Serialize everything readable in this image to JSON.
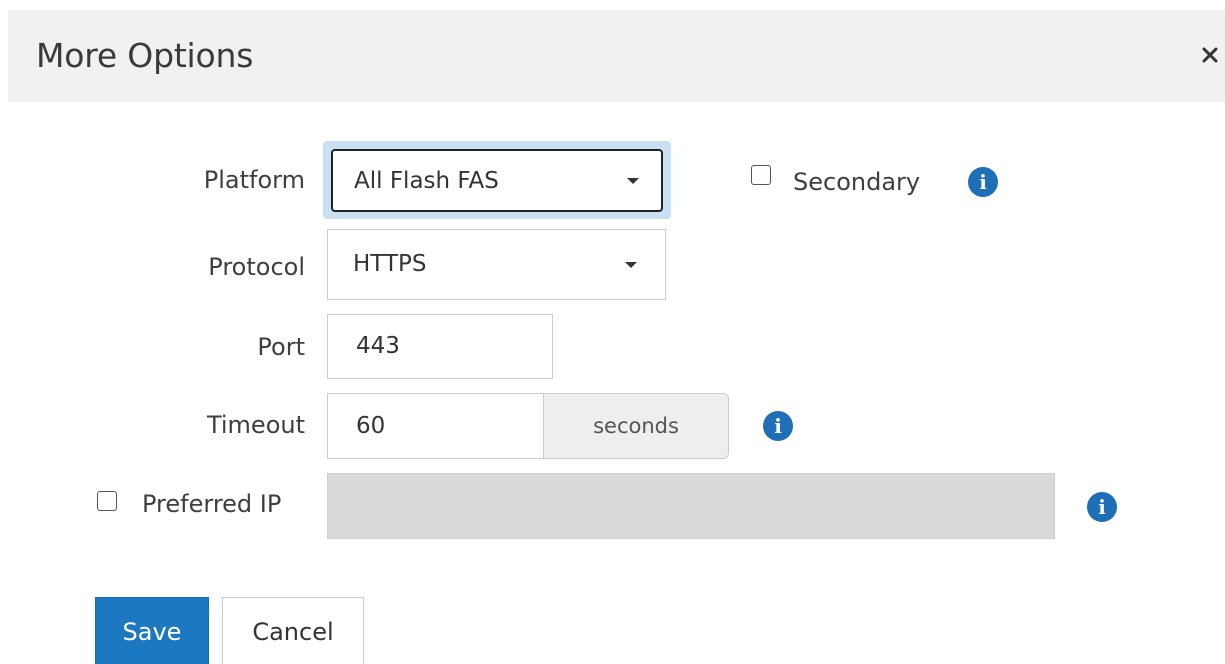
{
  "dialog": {
    "title": "More Options",
    "close_icon": "close-icon"
  },
  "form": {
    "platform": {
      "label": "Platform",
      "value": "All Flash FAS"
    },
    "secondary": {
      "label": "Secondary",
      "checked": false,
      "info_icon": "info-icon"
    },
    "protocol": {
      "label": "Protocol",
      "value": "HTTPS"
    },
    "port": {
      "label": "Port",
      "value": "443"
    },
    "timeout": {
      "label": "Timeout",
      "value": "60",
      "unit": "seconds",
      "info_icon": "info-icon"
    },
    "preferred_ip": {
      "label": "Preferred IP",
      "checked": false,
      "value": "",
      "info_icon": "info-icon"
    }
  },
  "actions": {
    "save_label": "Save",
    "cancel_label": "Cancel"
  },
  "colors": {
    "primary": "#1c78c0",
    "info": "#1f6fb8",
    "focus": "#c9dff2",
    "header_bg": "#f1f1f1",
    "disabled_field": "#d9d9d9"
  }
}
